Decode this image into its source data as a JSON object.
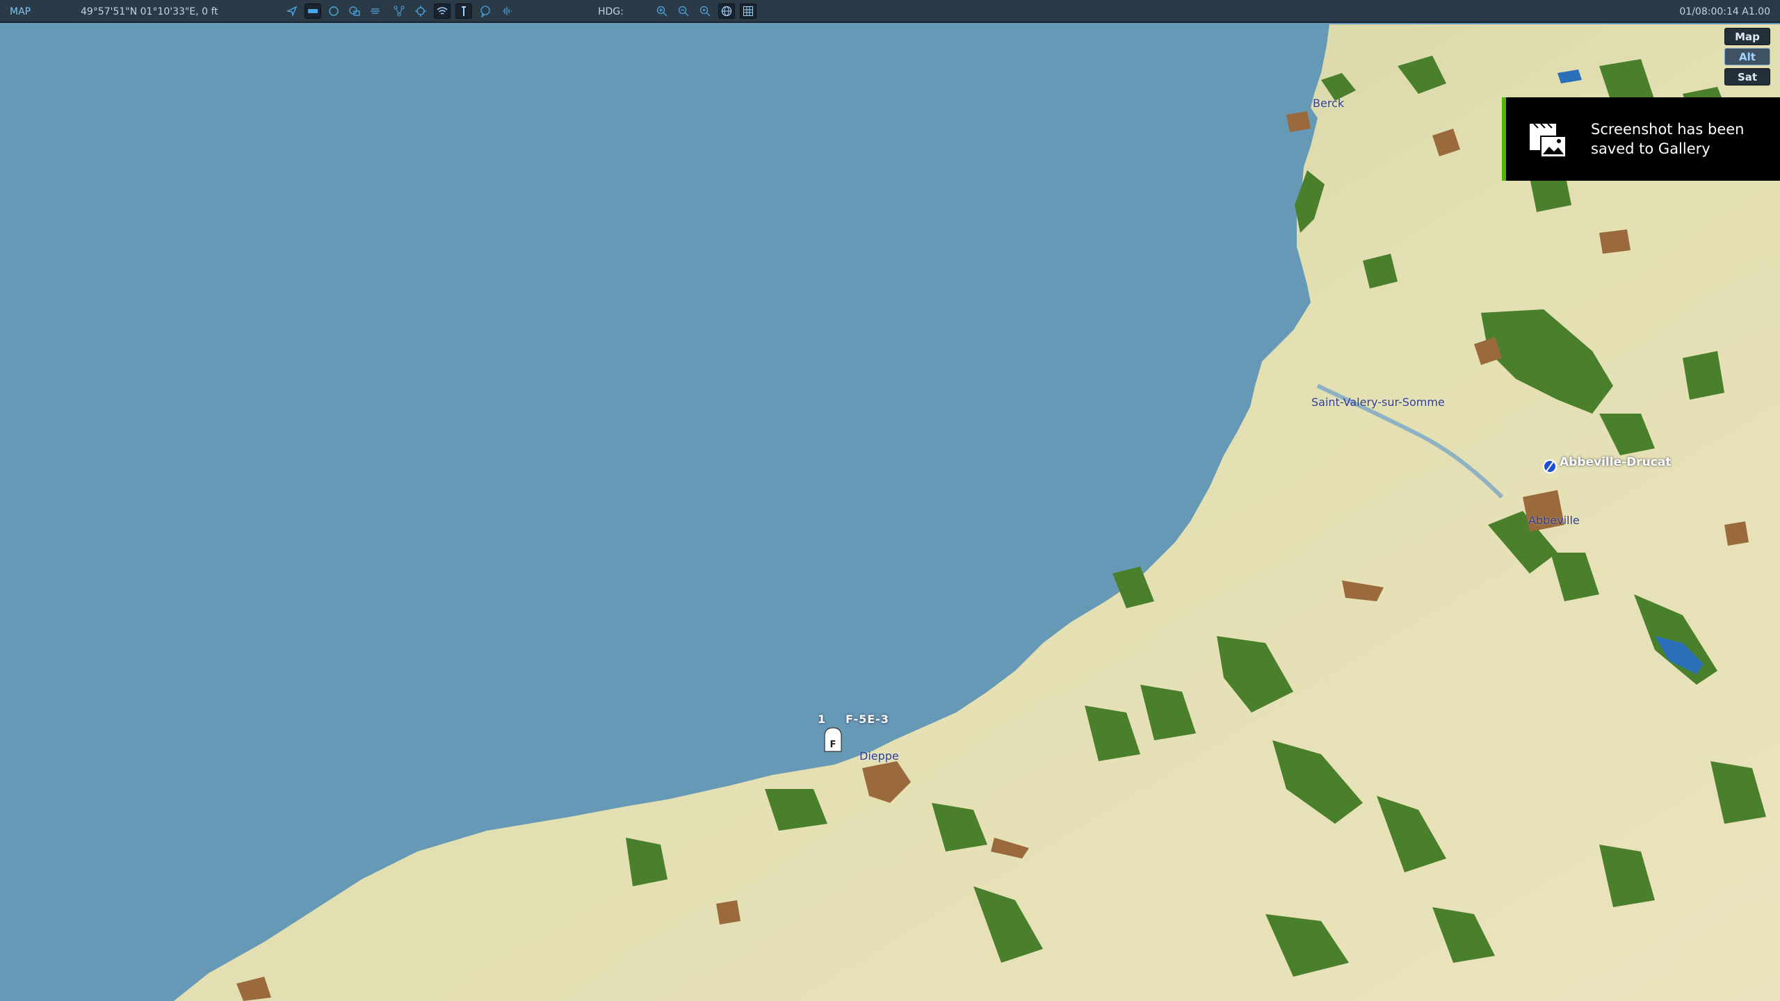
{
  "topbar": {
    "mode": "MAP",
    "coordinates": "49°57'51\"N 01°10'33\"E, 0 ft",
    "heading_label": "HDG:",
    "time": "01/08:00:14 A1.00",
    "icons_left": [
      "navigation-arrow-icon",
      "tag-icon",
      "circle-icon",
      "layers-icon",
      "wind-icon",
      "network-icon",
      "target-icon",
      "wifi-icon",
      "tower-icon",
      "chat-icon",
      "audio-icon"
    ],
    "icons_right": [
      "zoom-in-icon",
      "zoom-out-icon",
      "zoom-reset-icon",
      "globe-icon",
      "grid-icon"
    ]
  },
  "layers": {
    "map": "Map",
    "alt": "Alt",
    "sat": "Sat",
    "active": "alt"
  },
  "map": {
    "towns": [
      "Berck",
      "Saint-Valery-sur-Somme",
      "Abbeville",
      "Dieppe"
    ],
    "airfield": "Abbeville-Drucat",
    "unit": {
      "group": "1",
      "symbol": "F",
      "name": "F-5E-3"
    },
    "colors": {
      "sea": "#6699b6",
      "land": "#d8d7a8",
      "forest": "#4a7f2c",
      "urban": "#9b6a3c",
      "water": "#2a6fb8"
    }
  },
  "toast": {
    "message": "Screenshot has been saved to Gallery"
  }
}
